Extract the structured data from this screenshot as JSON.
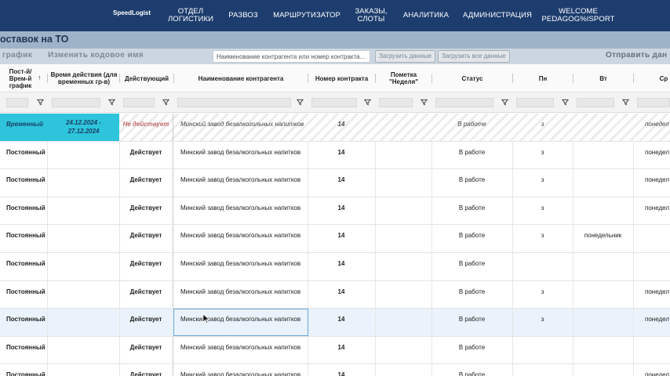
{
  "nav": {
    "brand": "SpeedLogist",
    "items": [
      {
        "label": "ОТДЕЛ\nЛОГИСТИКИ"
      },
      {
        "label": "РАЗВОЗ"
      },
      {
        "label": "МАРШРУТИЗАТОР"
      },
      {
        "label": "ЗАКАЗЫ,\nСЛОТЫ"
      },
      {
        "label": "АНАЛИТИКА"
      },
      {
        "label": "АДМИНИСТРАЦИЯ"
      },
      {
        "label": "WELCOME\nPEDAGOG%ISPORT"
      }
    ]
  },
  "page": {
    "title": "оставок на ТО"
  },
  "toolbar": {
    "graph_button": "график",
    "rename_button": "Изменить кодовое имя",
    "search_placeholder": "Наименование контрагента или номер контракта...",
    "load_button": "Загрузить данные",
    "load_all_button": "Загрузить все данные",
    "send_button": "Отправить дан"
  },
  "columns": [
    {
      "label": "Пост-й/ Врем-й график"
    },
    {
      "label": "Время действия (для временных гр-в)"
    },
    {
      "label": "Действующий"
    },
    {
      "label": "Наименование контрагента"
    },
    {
      "label": "Номер контракта"
    },
    {
      "label": "Пометка \"Неделя\""
    },
    {
      "label": "Статус"
    },
    {
      "label": "Пн"
    },
    {
      "label": "Вт"
    },
    {
      "label": "Ср"
    }
  ],
  "rows": [
    {
      "type": "Временный",
      "period": "24.12.2024 -\n27.12.2024",
      "active": "Не действует",
      "contractor": "Минский завод безалкогольных напитков",
      "contract": "14",
      "week": "",
      "status": "В работе",
      "mon": "з",
      "tue": "",
      "wed": "понедел"
    },
    {
      "type": "Постоянный",
      "period": "",
      "active": "Действует",
      "contractor": "Минский завод безалкогольных напитков",
      "contract": "14",
      "week": "",
      "status": "В работе",
      "mon": "з",
      "tue": "",
      "wed": "понедел"
    },
    {
      "type": "Постоянный",
      "period": "",
      "active": "Действует",
      "contractor": "Минский завод безалкогольных напитков",
      "contract": "14",
      "week": "",
      "status": "В работе",
      "mon": "з",
      "tue": "",
      "wed": "понедел"
    },
    {
      "type": "Постоянный",
      "period": "",
      "active": "Действует",
      "contractor": "Минский завод безалкогольных напитков",
      "contract": "14",
      "week": "",
      "status": "В работе",
      "mon": "з",
      "tue": "",
      "wed": "понедел"
    },
    {
      "type": "Постоянный",
      "period": "",
      "active": "Действует",
      "contractor": "Минский завод безалкогольных напитков",
      "contract": "14",
      "week": "",
      "status": "В работе",
      "mon": "з",
      "tue": "понедельник",
      "wed": ""
    },
    {
      "type": "Постоянный",
      "period": "",
      "active": "Действует",
      "contractor": "Минский завод безалкогольных напитков",
      "contract": "14",
      "week": "",
      "status": "В работе",
      "mon": "",
      "tue": "",
      "wed": ""
    },
    {
      "type": "Постоянный",
      "period": "",
      "active": "Действует",
      "contractor": "Минский завод безалкогольных напитков",
      "contract": "14",
      "week": "",
      "status": "В работе",
      "mon": "з",
      "tue": "",
      "wed": "понедел"
    },
    {
      "type": "Постоянный",
      "period": "",
      "active": "Действует",
      "contractor": "Минский завод безалкогольных напитков",
      "contract": "14",
      "week": "",
      "status": "В работе",
      "mon": "з",
      "tue": "",
      "wed": "понедел"
    },
    {
      "type": "Постоянный",
      "period": "",
      "active": "Действует",
      "contractor": "Минский завод безалкогольных напитков",
      "contract": "14",
      "week": "",
      "status": "В работе",
      "mon": "",
      "tue": "",
      "wed": ""
    },
    {
      "type": "Постоянный",
      "period": "",
      "active": "Действует",
      "contractor": "Минский завод безалкогольных напитков",
      "contract": "14",
      "week": "",
      "status": "В работе",
      "mon": "",
      "tue": "",
      "wed": "понедел"
    }
  ]
}
